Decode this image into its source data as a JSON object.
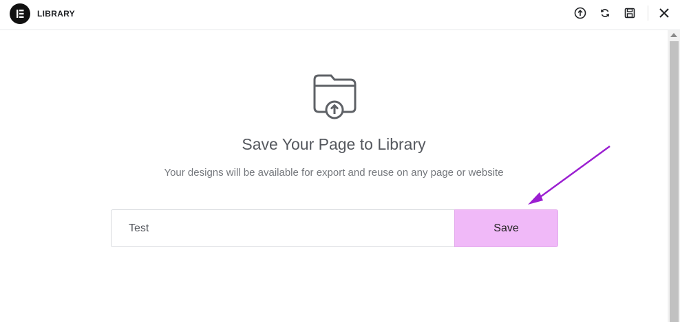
{
  "header": {
    "title": "LIBRARY",
    "icons": [
      "elementor-logo-icon",
      "upload-icon",
      "sync-icon",
      "save-icon",
      "close-icon"
    ]
  },
  "main": {
    "icon": "folder-upload-icon",
    "heading": "Save Your Page to Library",
    "subtext": "Your designs will be available for export and reuse on any page or website",
    "input": {
      "value": "Test",
      "placeholder": ""
    },
    "save_label": "Save"
  },
  "colors": {
    "save_button_bg": "#f0b9f8",
    "annotation_arrow": "#9b1fd1",
    "text_gray": "#55585e"
  }
}
